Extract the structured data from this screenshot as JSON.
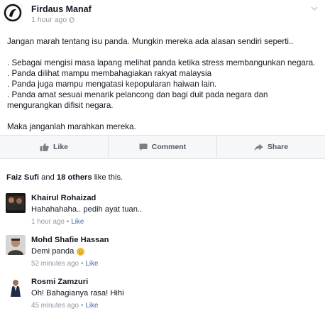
{
  "post": {
    "author": "Firdaus Manaf",
    "time": "1 hour ago",
    "privacy_icon": "globe-icon",
    "menu_icon": "chevron-down-icon",
    "lines": [
      "Jangan marah tentang isu panda. Mungkin mereka ada alasan sendiri seperti..",
      "",
      ". Sebagai mengisi masa lapang melihat panda ketika stress membangunkan negara.",
      ". Panda dilihat mampu membahagiakan rakyat malaysia",
      ". Panda juga mampu mengatasi kepopularan haiwan lain.",
      ". Panda amat sesuai menarik pelancong dan bagi duit pada negara dan",
      "mengurangkan difisit negara.",
      "",
      "Maka janganlah marahkan mereka."
    ]
  },
  "actions": {
    "like": "Like",
    "comment": "Comment",
    "share": "Share"
  },
  "likes": {
    "first_name": "Faiz Sufi",
    "connector": " and ",
    "others": "18 others",
    "suffix": " like this."
  },
  "comments": [
    {
      "name": "Khairul Rohaizad",
      "text": "Hahahahaha.. pedih ayat tuan..",
      "time": "1 hour ago",
      "like": "Like"
    },
    {
      "name": "Mohd Shafie Hassan",
      "text": "Demi panda",
      "emoji": "smiley-icon",
      "time": "52 minutes ago",
      "like": "Like"
    },
    {
      "name": "Rosmi Zamzuri",
      "text": "Oh! Bahagianya rasa! Hihi",
      "time": "45 minutes ago",
      "like": "Like"
    }
  ],
  "colors": {
    "link": "#4267b2",
    "meta": "#9197a3",
    "action_bar_bg": "#f6f7f9"
  }
}
